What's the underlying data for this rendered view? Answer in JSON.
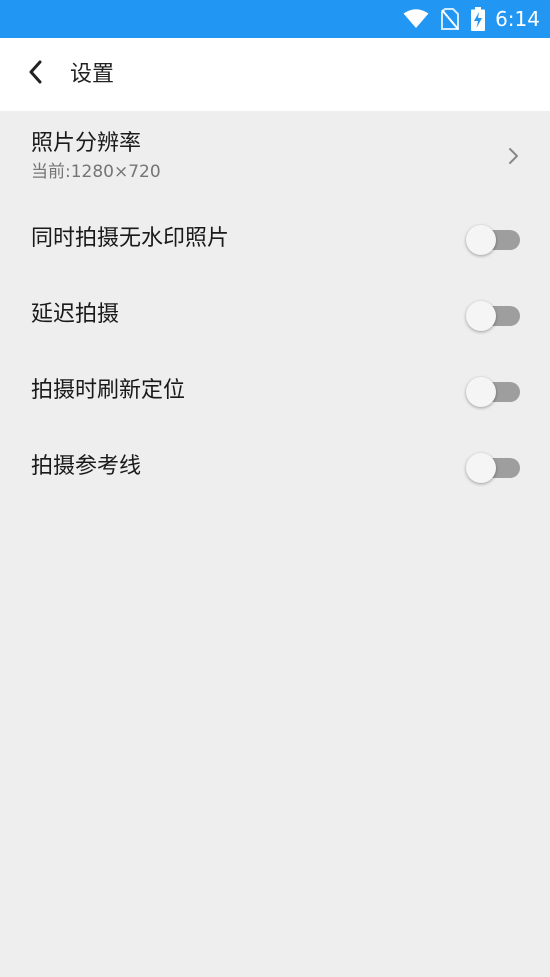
{
  "status_bar": {
    "time": "6:14",
    "icons": [
      "wifi-icon",
      "no-sim-icon",
      "battery-charging-icon"
    ],
    "background": "#2196f3"
  },
  "app_bar": {
    "back_icon": "chevron-left-icon",
    "title": "设置"
  },
  "settings": {
    "resolution": {
      "title": "照片分辨率",
      "subtitle": "当前:1280×720",
      "icon": "chevron-right-icon"
    },
    "items": [
      {
        "title": "同时拍摄无水印照片",
        "enabled": false
      },
      {
        "title": "延迟拍摄",
        "enabled": false
      },
      {
        "title": "拍摄时刷新定位",
        "enabled": false
      },
      {
        "title": "拍摄参考线",
        "enabled": false
      }
    ]
  },
  "colors": {
    "page_background": "#eeeeee",
    "toggle_track_off": "#9e9e9e",
    "toggle_thumb": "#f5f5f5"
  }
}
